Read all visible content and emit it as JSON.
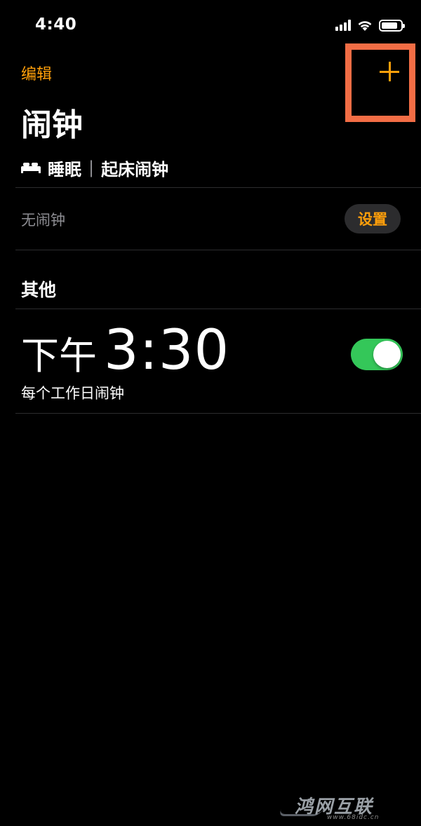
{
  "status_bar": {
    "time": "4:40",
    "signal_icon": "cellular-signal-icon",
    "wifi_icon": "wifi-icon",
    "battery_icon": "battery-icon",
    "battery_level": 0.85
  },
  "nav": {
    "edit_label": "编辑",
    "add_icon": "plus-icon",
    "title": "闹钟"
  },
  "sleep": {
    "icon": "bed-icon",
    "label": "睡眠",
    "separator": "|",
    "sub_label": "起床闹钟",
    "status": "无闹钟",
    "setup_label": "设置"
  },
  "other": {
    "section_title": "其他",
    "alarms": [
      {
        "period": "下午",
        "time": "3:30",
        "label": "每个工作日闹钟",
        "enabled": true
      }
    ]
  },
  "watermark": {
    "text": "鸿网互联",
    "url": "www.68idc.cn"
  },
  "colors": {
    "accent": "#ff9f0a",
    "toggle_on": "#34c759",
    "highlight_box": "#f26d45",
    "background": "#000000",
    "secondary_text": "#8e8e93"
  }
}
